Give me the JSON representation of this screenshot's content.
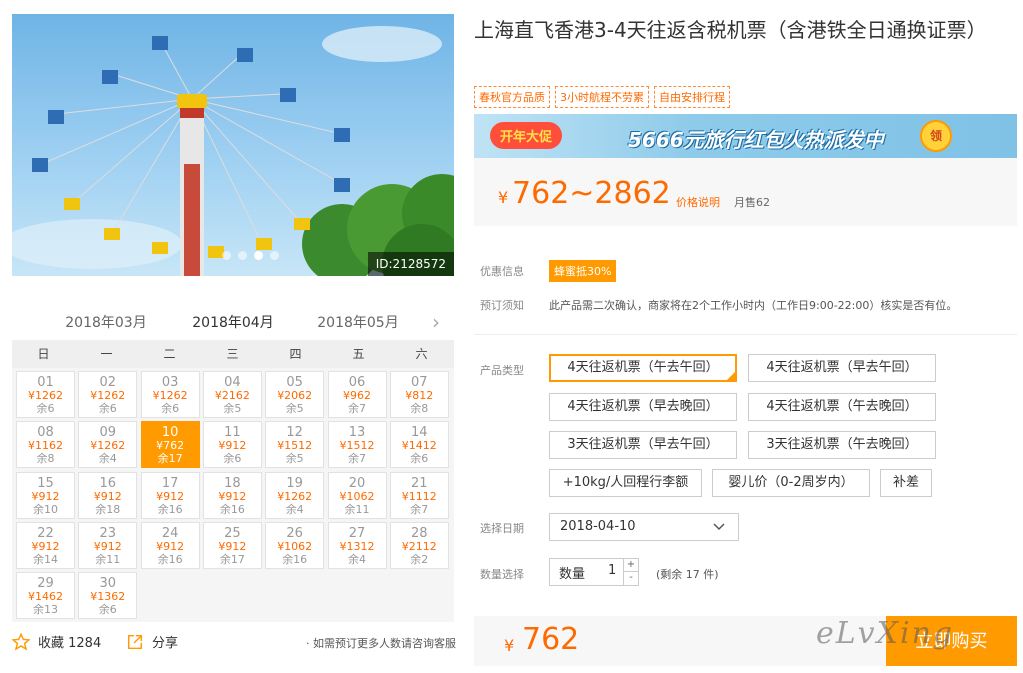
{
  "photo": {
    "id_label": "ID:2128572"
  },
  "calendar": {
    "months": [
      "2018年03月",
      "2018年04月",
      "2018年05月"
    ],
    "next_icon": "chevron-right-icon",
    "weekdays": [
      "日",
      "一",
      "二",
      "三",
      "四",
      "五",
      "六"
    ],
    "days": [
      {
        "date": "01",
        "price": "¥1262",
        "stock": "余6"
      },
      {
        "date": "02",
        "price": "¥1262",
        "stock": "余6"
      },
      {
        "date": "03",
        "price": "¥1262",
        "stock": "余6"
      },
      {
        "date": "04",
        "price": "¥2162",
        "stock": "余5"
      },
      {
        "date": "05",
        "price": "¥2062",
        "stock": "余5"
      },
      {
        "date": "06",
        "price": "¥962",
        "stock": "余7"
      },
      {
        "date": "07",
        "price": "¥812",
        "stock": "余8"
      },
      {
        "date": "08",
        "price": "¥1162",
        "stock": "余8"
      },
      {
        "date": "09",
        "price": "¥1262",
        "stock": "余4"
      },
      {
        "date": "10",
        "price": "¥762",
        "stock": "余17"
      },
      {
        "date": "11",
        "price": "¥912",
        "stock": "余6"
      },
      {
        "date": "12",
        "price": "¥1512",
        "stock": "余5"
      },
      {
        "date": "13",
        "price": "¥1512",
        "stock": "余7"
      },
      {
        "date": "14",
        "price": "¥1412",
        "stock": "余6"
      },
      {
        "date": "15",
        "price": "¥912",
        "stock": "余10"
      },
      {
        "date": "16",
        "price": "¥912",
        "stock": "余18"
      },
      {
        "date": "17",
        "price": "¥912",
        "stock": "余16"
      },
      {
        "date": "18",
        "price": "¥912",
        "stock": "余16"
      },
      {
        "date": "19",
        "price": "¥1262",
        "stock": "余4"
      },
      {
        "date": "20",
        "price": "¥1062",
        "stock": "余11"
      },
      {
        "date": "21",
        "price": "¥1112",
        "stock": "余7"
      },
      {
        "date": "22",
        "price": "¥912",
        "stock": "余14"
      },
      {
        "date": "23",
        "price": "¥912",
        "stock": "余11"
      },
      {
        "date": "24",
        "price": "¥912",
        "stock": "余16"
      },
      {
        "date": "25",
        "price": "¥912",
        "stock": "余17"
      },
      {
        "date": "26",
        "price": "¥1062",
        "stock": "余16"
      },
      {
        "date": "27",
        "price": "¥1312",
        "stock": "余4"
      },
      {
        "date": "28",
        "price": "¥2112",
        "stock": "余2"
      },
      {
        "date": "29",
        "price": "¥1462",
        "stock": "余13"
      },
      {
        "date": "30",
        "price": "¥1362",
        "stock": "余6"
      }
    ]
  },
  "actions": {
    "favorite_label": "收藏 1284",
    "share_label": "分享",
    "consult_text": "· 如需预订更多人数请咨询客服"
  },
  "product": {
    "title": "上海直飞香港3-4天往返含税机票（含港铁全日通换证票）",
    "tags": [
      "春秋官方品质",
      "3小时航程不劳累",
      "自由安排行程"
    ]
  },
  "banner": {
    "badge": "开年大促",
    "text": "5666元旅行红包火热派发中",
    "coin": "领"
  },
  "price": {
    "currency": "¥",
    "range": "762~2862",
    "note": "价格说明",
    "monthly_sales": "月售62"
  },
  "info": {
    "promo_label": "优惠信息",
    "promo_badge": "蜂蜜抵30%",
    "notice_label": "预订须知",
    "notice_text": "此产品需二次确认，商家将在2个工作小时内（工作日9:00-22:00）核实是否有位。"
  },
  "options": {
    "label": "产品类型",
    "items": [
      "4天往返机票（午去午回）",
      "4天往返机票（早去午回）",
      "4天往返机票（早去晚回）",
      "4天往返机票（午去晚回）",
      "3天往返机票（早去午回）",
      "3天往返机票（午去晚回）",
      "+10kg/人回程行李额",
      "婴儿价（0-2周岁内）",
      "补差"
    ]
  },
  "date_select": {
    "label": "选择日期",
    "value": "2018-04-10"
  },
  "quantity": {
    "label": "数量选择",
    "field_label": "数量",
    "value": "1",
    "up": "+",
    "down": "-",
    "stock_text": "(剩余 17 件)"
  },
  "buy": {
    "currency": "¥",
    "total": "762",
    "button": "立即购买"
  },
  "watermark": "eLvXing",
  "colors": {
    "accent": "#ff9a00",
    "price": "#ff6a00"
  }
}
